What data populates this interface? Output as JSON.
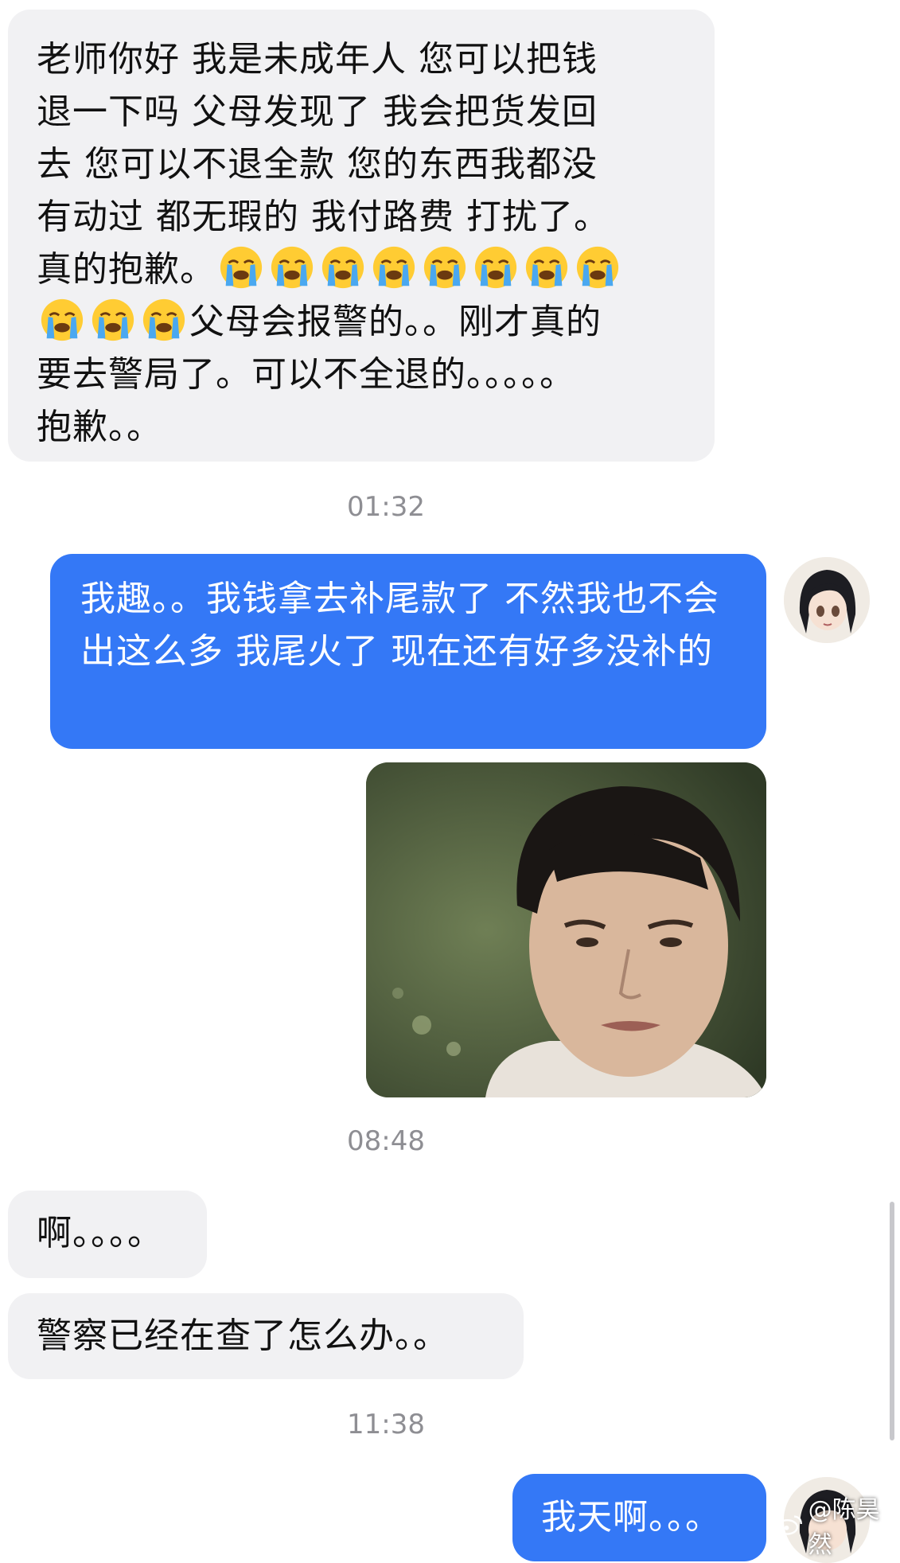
{
  "messages": [
    {
      "side": "incoming",
      "text_lines": [
        "老师你好 我是未成年人 您可以把钱",
        "退一下吗 父母发现了 我会把货发回",
        "去 您可以不退全款 您的东西我都没",
        "有动过 都无瑕的 我付路费 打扰了。",
        "真的抱歉。",
        "父母会报警的。。刚才真的",
        "要去警局了。可以不全退的。。。。。",
        "抱歉。。"
      ],
      "emoji": "loudly-crying-face",
      "emoji_count_line5": 8,
      "emoji_count_line6": 3
    },
    {
      "type": "timestamp",
      "text": "01:32"
    },
    {
      "side": "outgoing",
      "text": "我趣。。我钱拿去补尾款了 不然我也不会出这么多 我尾火了 现在还有好多没补的"
    },
    {
      "side": "outgoing",
      "type": "image",
      "content": "meme photo of a young man with a blank expression"
    },
    {
      "type": "timestamp",
      "text": "08:48"
    },
    {
      "side": "incoming",
      "text": "啊。。。。"
    },
    {
      "side": "incoming",
      "text": "警察已经在查了怎么办。。"
    },
    {
      "type": "timestamp",
      "text": "11:38"
    },
    {
      "side": "outgoing",
      "text": "我天啊。。。"
    }
  ],
  "watermark": {
    "text": "@陈昊然",
    "icon": "weibo-icon"
  },
  "colors": {
    "outgoing_bubble": "#3478f6",
    "incoming_bubble": "#f1f1f3",
    "timestamp": "#8e8e93"
  }
}
